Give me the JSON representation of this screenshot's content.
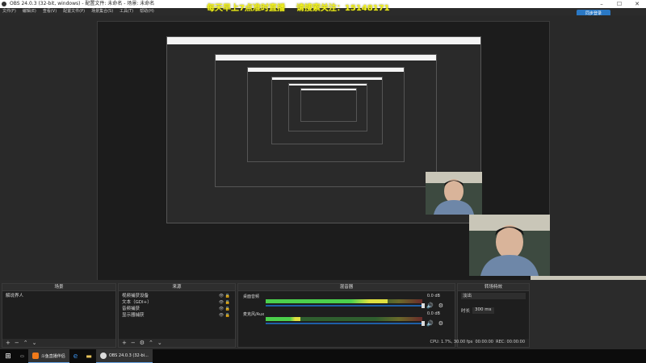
{
  "window": {
    "title": "OBS 24.0.3 (32-bit, windows) - 配置文件: 未命名 - 场景: 未命名",
    "controls": [
      "–",
      "☐",
      "✕"
    ]
  },
  "menu": {
    "items": [
      "文件(F)",
      "编辑(E)",
      "查看(V)",
      "配置文件(P)",
      "场景集合(S)",
      "工具(T)",
      "帮助(H)"
    ]
  },
  "overlay": {
    "line1": "每天早上7点准时直播",
    "line2": "请搜索关注：15148171"
  },
  "login_button": "同步登录",
  "docks": {
    "scenes": {
      "title": "场景",
      "items": [
        "解说界人"
      ]
    },
    "sources": {
      "title": "来源",
      "items": [
        "视频捕获设备",
        "文本（GDI+）",
        "音频捕获",
        "显示器捕获"
      ]
    },
    "mixer": {
      "title": "混音器",
      "channels": [
        {
          "name": "桌面音频",
          "db": "0.0 dB",
          "level": 0.78
        },
        {
          "name": "麦克风/Aux",
          "db": "0.0 dB",
          "level": 0.22
        }
      ]
    },
    "transitions": {
      "title": "转场特效",
      "type": "淡出",
      "duration_label": "时长",
      "duration": "300 ms"
    }
  },
  "footer_icons": [
    "+",
    "−",
    "⌃",
    "⌄"
  ],
  "status": {
    "cpu": "CPU: 1.7%, 30.00 fps",
    "time": "00:00:00",
    "rec": "REC: 00:00:00"
  },
  "taskbar": {
    "items": [
      {
        "label": "斗鱼直播伴侣"
      },
      {
        "label": "OBS 24.0.3 (32-bi..."
      }
    ]
  },
  "colors": {
    "overlay_text": "#f2f21a",
    "accent": "#2a78c4",
    "meter_green": "#4cd04c"
  }
}
